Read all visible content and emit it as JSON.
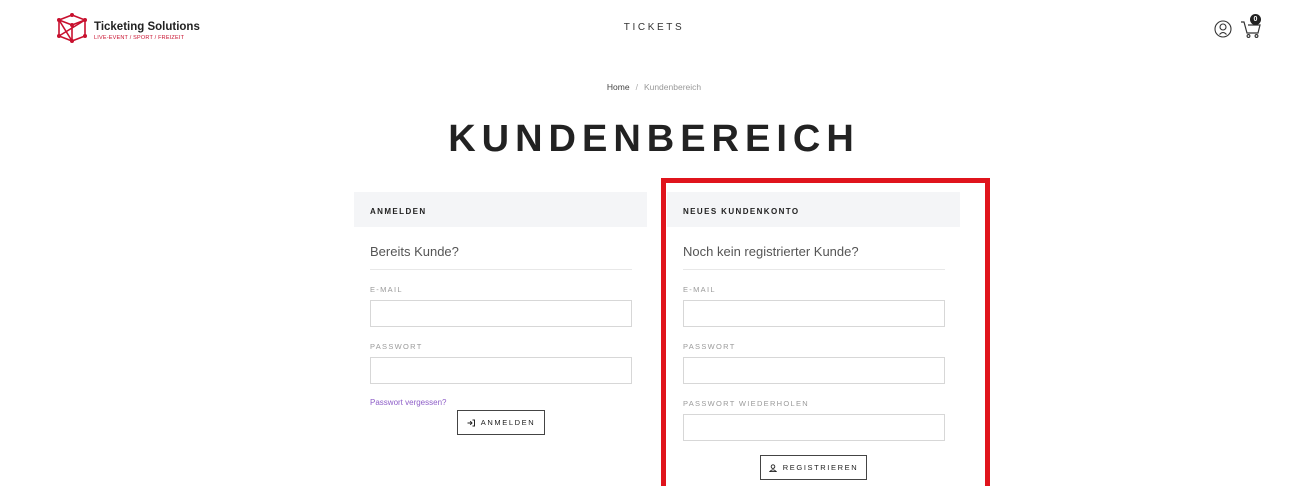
{
  "header": {
    "logo_title": "Ticketing Solutions",
    "logo_subtitle": "LIVE-EVENT / SPORT / FREIZEIT",
    "nav_tickets": "TICKETS",
    "cart_count": "0"
  },
  "breadcrumb": {
    "home": "Home",
    "separator": "/",
    "current": "Kundenbereich"
  },
  "page_title": "KUNDENBEREICH",
  "login": {
    "heading": "ANMELDEN",
    "subtitle": "Bereits Kunde?",
    "email_label": "E-MAIL",
    "password_label": "PASSWORT",
    "forgot_link": "Passwort vergessen?",
    "submit_label": "ANMELDEN"
  },
  "register": {
    "heading": "NEUES KUNDENKONTO",
    "subtitle": "Noch kein registrierter Kunde?",
    "email_label": "E-MAIL",
    "password_label": "PASSWORT",
    "password_repeat_label": "PASSWORT WIEDERHOLEN",
    "submit_label": "REGISTRIEREN"
  },
  "colors": {
    "highlight_frame": "#e0141c",
    "panel_header_bg": "#f4f5f7",
    "link": "#8e5ec8",
    "brand_red": "#c8102e"
  },
  "icons": {
    "logo": "cube-network-icon",
    "user": "user-circle-icon",
    "cart": "cart-icon",
    "login_button": "sign-in-icon",
    "register_button": "user-icon"
  }
}
